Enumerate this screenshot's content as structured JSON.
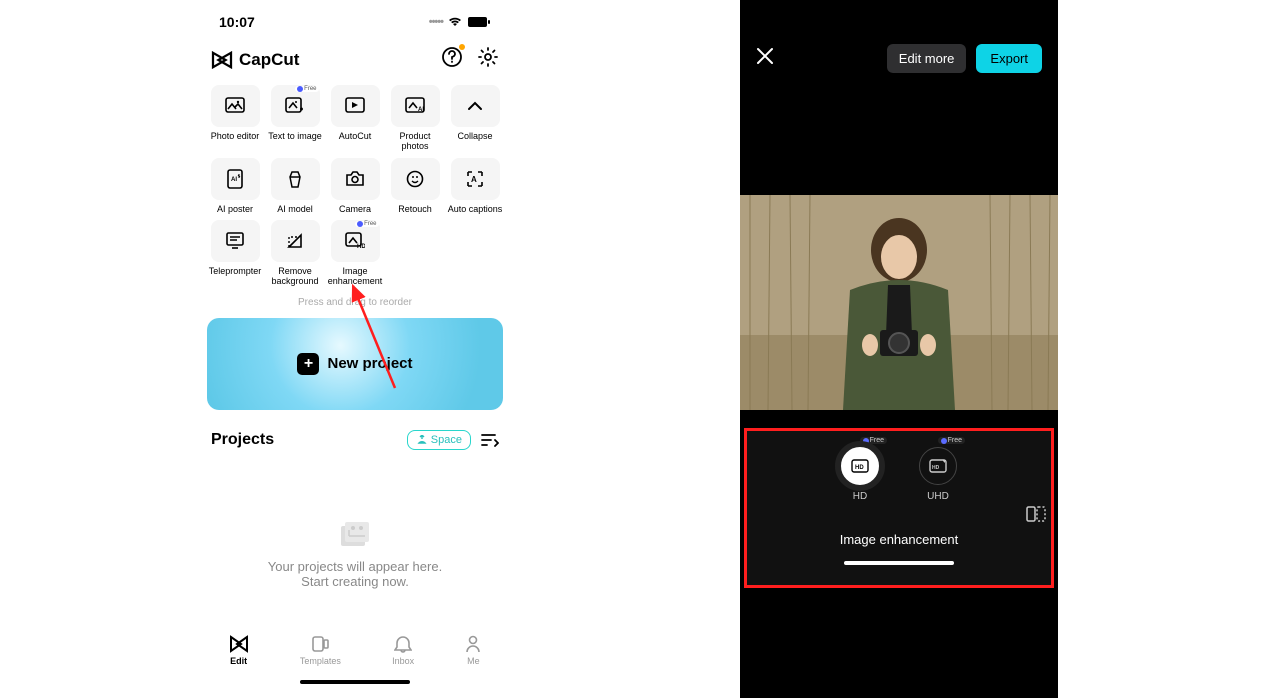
{
  "left": {
    "time": "10:07",
    "brand": "CapCut",
    "tools": [
      {
        "label": "Photo editor",
        "free": false
      },
      {
        "label": "Text to image",
        "free": true
      },
      {
        "label": "AutoCut",
        "free": false
      },
      {
        "label": "Product photos",
        "free": false
      },
      {
        "label": "Collapse",
        "free": false
      },
      {
        "label": "AI poster",
        "free": false
      },
      {
        "label": "AI model",
        "free": false
      },
      {
        "label": "Camera",
        "free": false
      },
      {
        "label": "Retouch",
        "free": false
      },
      {
        "label": "Auto captions",
        "free": false
      },
      {
        "label": "Teleprompter",
        "free": false
      },
      {
        "label": "Remove background",
        "free": false
      },
      {
        "label": "Image enhancement",
        "free": true
      }
    ],
    "drag_hint": "Press and drag to reorder",
    "new_project": "New project",
    "projects_title": "Projects",
    "space_btn": "Space",
    "empty1": "Your projects will appear here.",
    "empty2": "Start creating now.",
    "nav": [
      "Edit",
      "Templates",
      "Inbox",
      "Me"
    ],
    "free_badge": "Free"
  },
  "right": {
    "edit_more": "Edit more",
    "export": "Export",
    "options": [
      {
        "label": "HD",
        "selected": true
      },
      {
        "label": "UHD",
        "selected": false
      }
    ],
    "panel_title": "Image enhancement",
    "free_badge": "Free"
  }
}
